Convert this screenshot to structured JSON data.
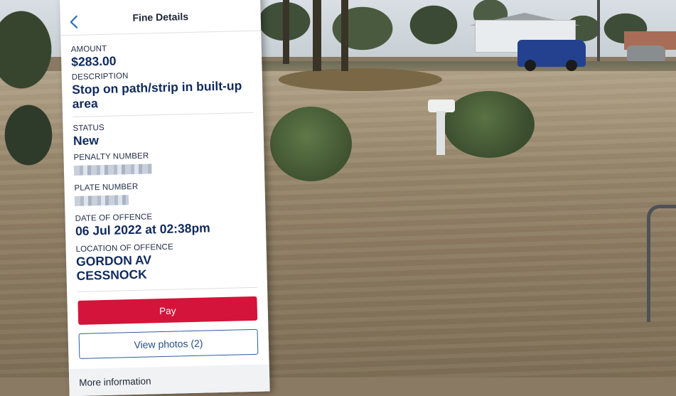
{
  "header": {
    "title": "Fine Details"
  },
  "fine": {
    "amount_label": "AMOUNT",
    "amount": "$283.00",
    "description_label": "DESCRIPTION",
    "description": "Stop on path/strip in built-up area",
    "status_label": "STATUS",
    "status": "New",
    "penalty_label": "PENALTY NUMBER",
    "plate_label": "PLATE NUMBER",
    "date_label": "DATE OF OFFENCE",
    "date": "06 Jul 2022 at 02:38pm",
    "location_label": "LOCATION OF OFFENCE",
    "location_line1": "GORDON AV",
    "location_line2": "CESSNOCK"
  },
  "actions": {
    "pay_label": "Pay",
    "photos_label": "View photos (2)"
  },
  "footer": {
    "more_label": "More information"
  },
  "colors": {
    "pay_button": "#d4143a",
    "accent_text": "#102a5c",
    "back_icon": "#2a6ebb"
  },
  "icons": {
    "back": "chevron-left-icon"
  }
}
